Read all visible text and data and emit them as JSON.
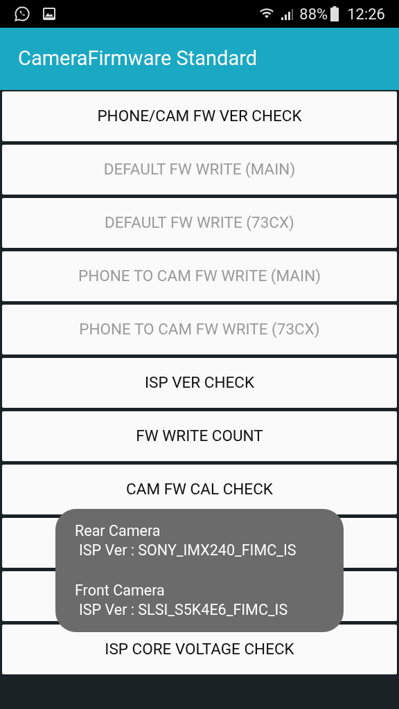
{
  "status_bar": {
    "battery": "88%",
    "time": "12:26"
  },
  "app_bar": {
    "title": "CameraFirmware Standard"
  },
  "buttons": [
    {
      "kind": "labeled",
      "label": "PHONE/CAM FW VER CHECK",
      "disabled": false
    },
    {
      "kind": "labeled",
      "label": "DEFAULT FW WRITE (MAIN)",
      "disabled": true
    },
    {
      "kind": "labeled",
      "label": "DEFAULT FW WRITE (73CX)",
      "disabled": true
    },
    {
      "kind": "labeled",
      "label": "PHONE TO CAM FW WRITE (MAIN)",
      "disabled": true
    },
    {
      "kind": "labeled",
      "label": "PHONE TO CAM FW WRITE (73CX)",
      "disabled": true
    },
    {
      "kind": "labeled",
      "label": "ISP VER CHECK",
      "disabled": false
    },
    {
      "kind": "labeled",
      "label": "FW WRITE COUNT",
      "disabled": false
    },
    {
      "kind": "labeled",
      "label": "CAM FW CAL CHECK",
      "disabled": false
    },
    {
      "kind": "covered"
    },
    {
      "kind": "covered"
    },
    {
      "kind": "labeled",
      "label": "ISP CORE VOLTAGE CHECK",
      "disabled": false
    }
  ],
  "toast": {
    "lines": [
      {
        "kind": "heading",
        "text": "Rear Camera"
      },
      {
        "kind": "value",
        "text": "ISP Ver : SONY_IMX240_FIMC_IS"
      },
      {
        "kind": "heading",
        "text": "Front Camera"
      },
      {
        "kind": "value",
        "text": "ISP Ver : SLSI_S5K4E6_FIMC_IS"
      }
    ]
  }
}
